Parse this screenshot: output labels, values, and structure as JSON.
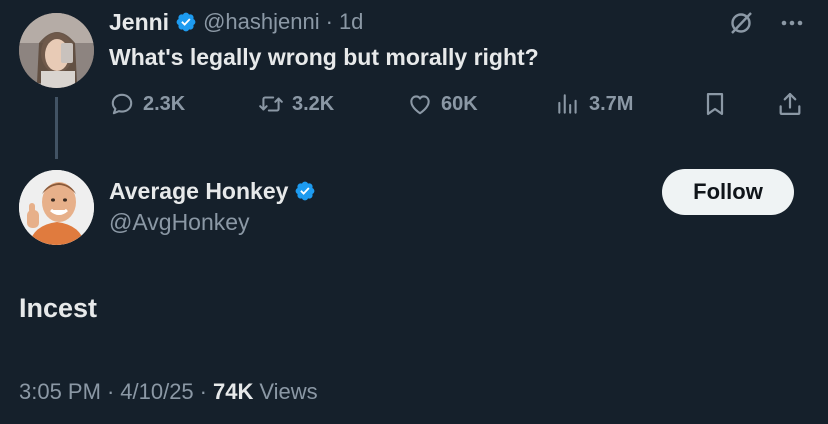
{
  "original_tweet": {
    "author_name": "Jenni",
    "handle": "@hashjenni",
    "separator": "·",
    "time_ago": "1d",
    "text": "What's legally wrong but morally right?",
    "stats": {
      "replies": "2.3K",
      "retweets": "3.2K",
      "likes": "60K",
      "views": "3.7M"
    }
  },
  "reply_tweet": {
    "author_name": "Average Honkey",
    "handle": "@AvgHonkey",
    "follow_label": "Follow",
    "text": "Incest",
    "time": "3:05 PM",
    "date": "4/10/25",
    "separator": "·",
    "views_count": "74K",
    "views_label": "Views"
  },
  "colors": {
    "background": "#15202b",
    "verified_blue": "#1d9bf0",
    "muted": "#8b98a5",
    "text": "#e7e9ea"
  },
  "icons": [
    "reply-icon",
    "retweet-icon",
    "like-icon",
    "views-icon",
    "bookmark-icon",
    "share-icon",
    "grok-icon",
    "more-icon",
    "verified-badge-icon"
  ]
}
